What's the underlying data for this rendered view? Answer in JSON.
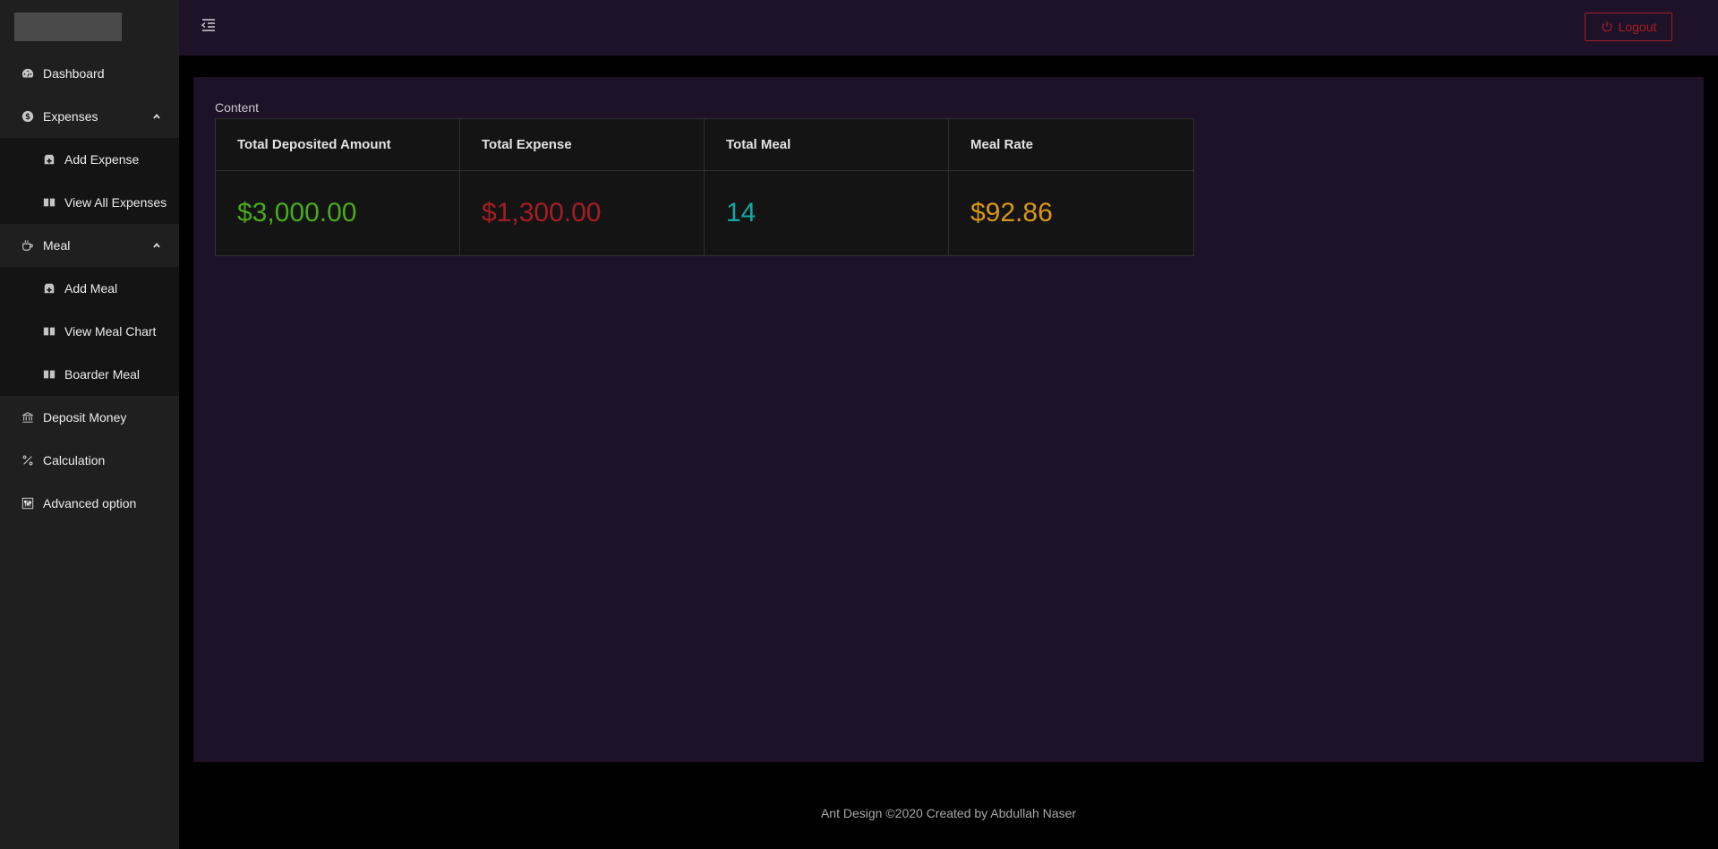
{
  "sidebar": {
    "items": [
      {
        "label": "Dashboard",
        "icon": "dashboard-icon"
      },
      {
        "label": "Expenses",
        "icon": "dollar-icon",
        "expanded": true,
        "children": [
          {
            "label": "Add Expense",
            "icon": "medicine-box-icon"
          },
          {
            "label": "View All Expenses",
            "icon": "read-icon"
          }
        ]
      },
      {
        "label": "Meal",
        "icon": "coffee-icon",
        "expanded": true,
        "children": [
          {
            "label": "Add Meal",
            "icon": "medicine-box-icon"
          },
          {
            "label": "View Meal Chart",
            "icon": "read-icon"
          },
          {
            "label": "Boarder Meal",
            "icon": "read-icon"
          }
        ]
      },
      {
        "label": "Deposit Money",
        "icon": "bank-icon"
      },
      {
        "label": "Calculation",
        "icon": "percentage-icon"
      },
      {
        "label": "Advanced option",
        "icon": "sliders-icon"
      }
    ]
  },
  "header": {
    "logout_label": "Logout"
  },
  "content": {
    "breadcrumb": "Content",
    "stats": [
      {
        "title": "Total Deposited Amount",
        "value": "$3,000.00",
        "color": "#49aa19"
      },
      {
        "title": "Total Expense",
        "value": "$1,300.00",
        "color": "#a61d24"
      },
      {
        "title": "Total Meal",
        "value": "14",
        "color": "#13a8a8"
      },
      {
        "title": "Meal Rate",
        "value": "$92.86",
        "color": "#d89614"
      }
    ]
  },
  "footer": {
    "text": "Ant Design ©2020 Created by Abdullah Naser"
  },
  "colors": {
    "sider_bg": "#1f1f1f",
    "submenu_bg": "#141414",
    "header_bg": "#1e1229",
    "content_bg": "#1e1229",
    "danger": "#a61d24"
  }
}
